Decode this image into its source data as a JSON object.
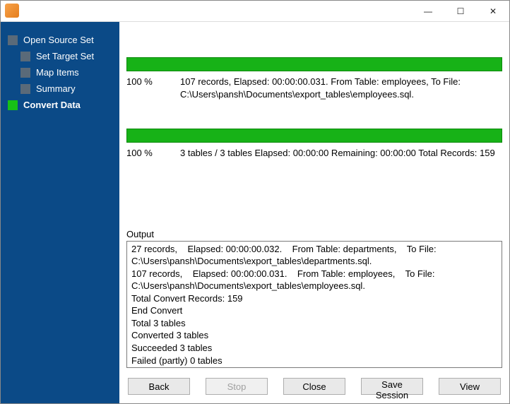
{
  "window": {
    "min": "—",
    "max": "☐",
    "close": "✕"
  },
  "sidebar": {
    "steps": [
      {
        "label": "Open Source Set",
        "child": false,
        "active": false
      },
      {
        "label": "Set Target Set",
        "child": true,
        "active": false
      },
      {
        "label": "Map Items",
        "child": true,
        "active": false
      },
      {
        "label": "Summary",
        "child": true,
        "active": false
      },
      {
        "label": "Convert Data",
        "child": false,
        "active": true
      }
    ]
  },
  "progress1": {
    "pct": "100 %",
    "info": "107 records,    Elapsed: 00:00:00.031.    From Table: employees,    To File: C:\\Users\\pansh\\Documents\\export_tables\\employees.sql."
  },
  "progress2": {
    "pct": "100 %",
    "info": "3 tables / 3 tables    Elapsed: 00:00:00    Remaining: 00:00:00    Total Records: 159"
  },
  "output": {
    "label": "Output",
    "text": "27 records,    Elapsed: 00:00:00.032.    From Table: departments,    To File: C:\\Users\\pansh\\Documents\\export_tables\\departments.sql.\n107 records,    Elapsed: 00:00:00.031.    From Table: employees,    To File: C:\\Users\\pansh\\Documents\\export_tables\\employees.sql.\nTotal Convert Records: 159\nEnd Convert\nTotal 3 tables\nConverted 3 tables\nSucceeded 3 tables\nFailed (partly) 0 tables\n"
  },
  "buttons": {
    "back": "Back",
    "stop": "Stop",
    "close": "Close",
    "save_session": "Save Session",
    "view": "View"
  }
}
